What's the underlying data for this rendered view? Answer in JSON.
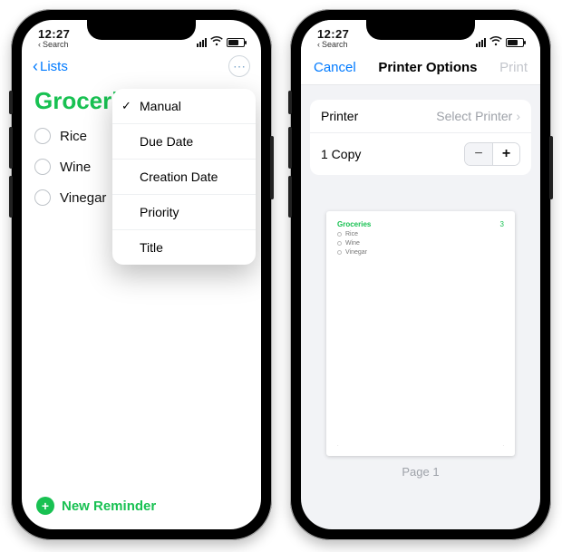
{
  "status": {
    "time": "12:27",
    "back_app": "Search"
  },
  "left": {
    "back": "Lists",
    "title": "Groceries",
    "items": [
      "Rice",
      "Wine",
      "Vinegar"
    ],
    "sort_menu": [
      "Manual",
      "Due Date",
      "Creation Date",
      "Priority",
      "Title"
    ],
    "sort_selected": "Manual",
    "new_reminder": "New Reminder"
  },
  "right": {
    "cancel": "Cancel",
    "title": "Printer Options",
    "print": "Print",
    "printer_label": "Printer",
    "printer_value": "Select Printer",
    "copies_label": "1 Copy",
    "preview": {
      "list_title": "Groceries",
      "count": "3",
      "items": [
        "Rice",
        "Wine",
        "Vinegar"
      ]
    },
    "page_label": "Page 1"
  }
}
